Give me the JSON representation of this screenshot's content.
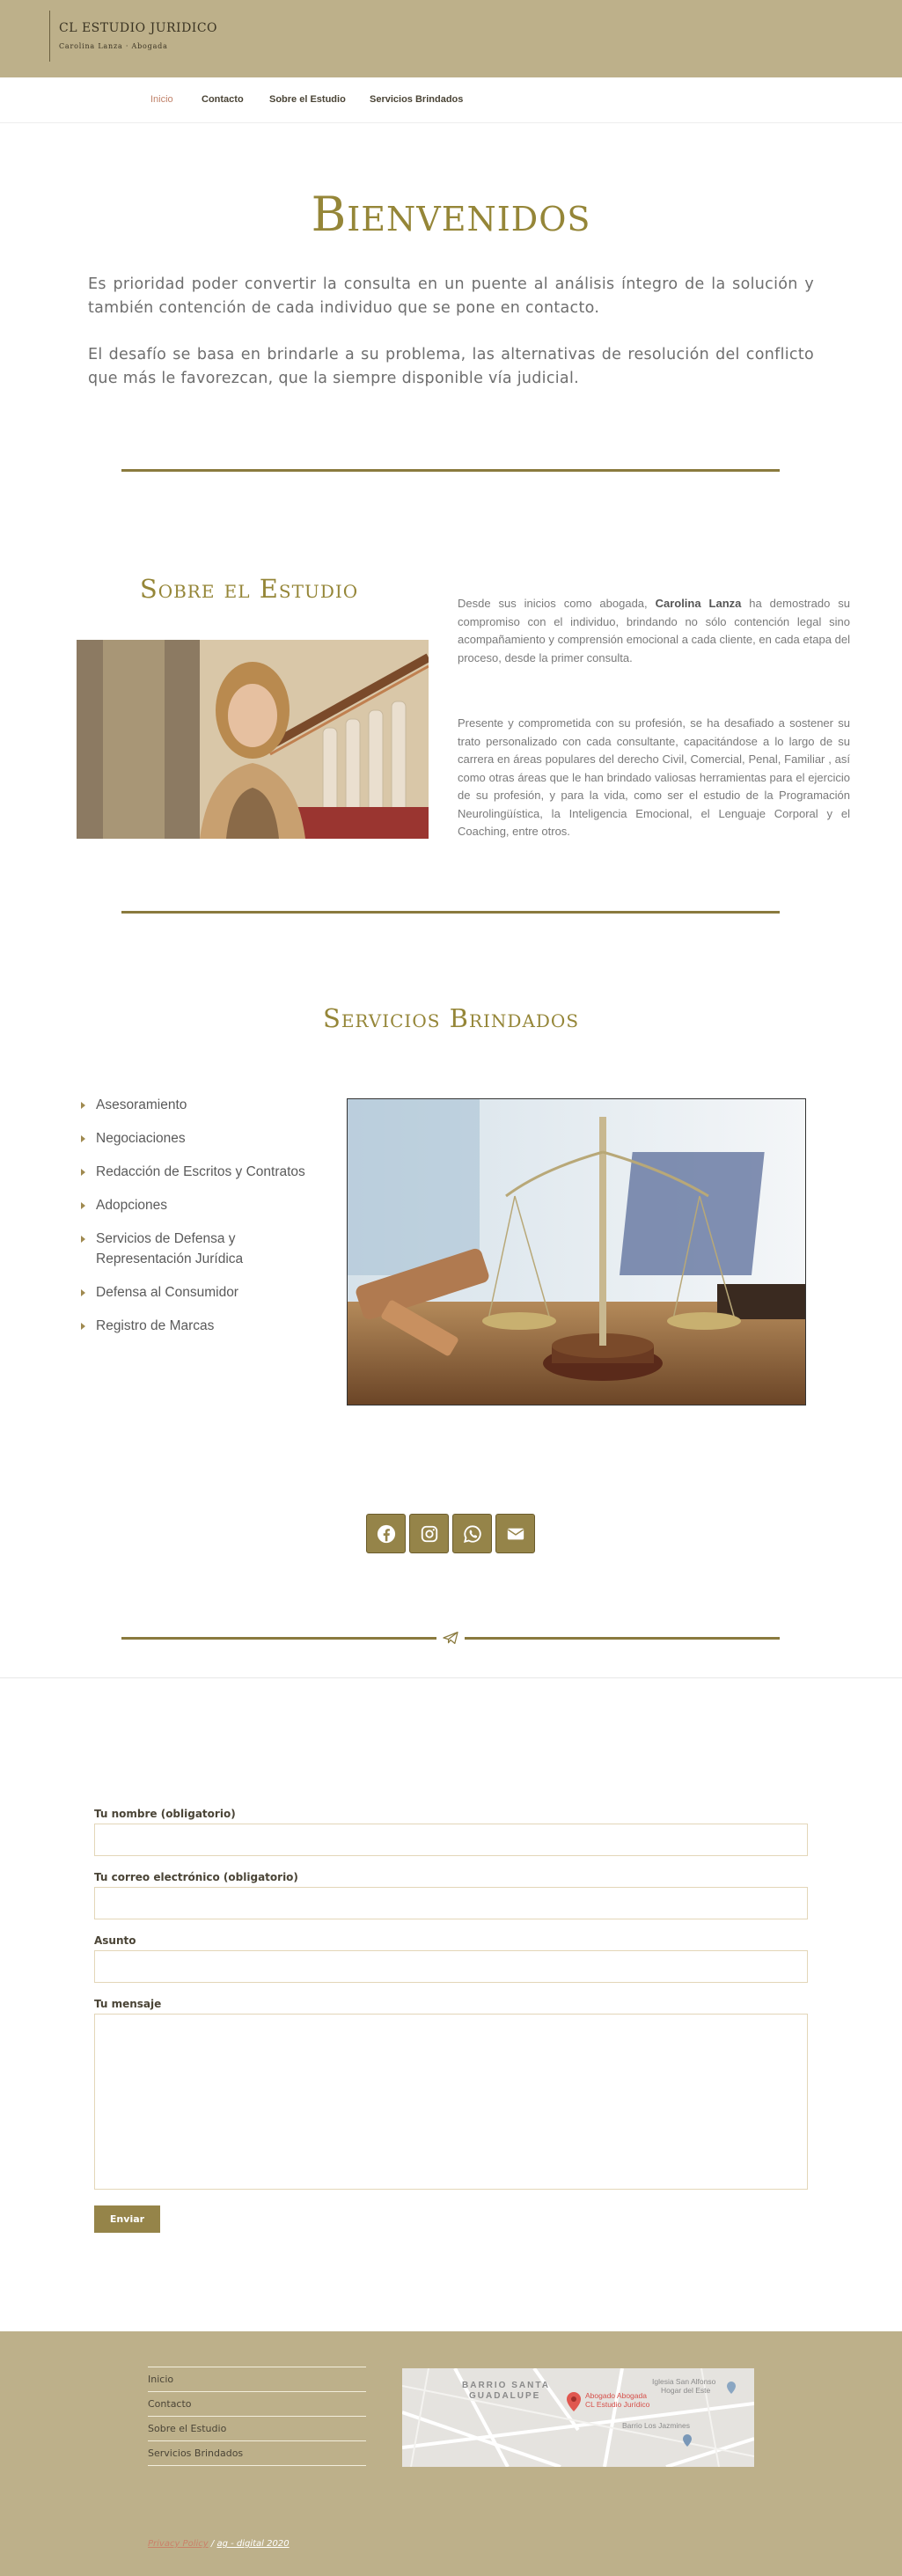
{
  "header": {
    "logo_title": "CL ESTUDIO JURIDICO",
    "logo_subtitle": "Carolina Lanza · Abogada"
  },
  "nav": {
    "items": [
      {
        "label": "Inicio",
        "active": true
      },
      {
        "label": "Contacto"
      },
      {
        "label": "Sobre el Estudio"
      },
      {
        "label": "Servicios Brindados"
      }
    ]
  },
  "welcome": {
    "title": "Bienvenidos",
    "paragraph1": "Es prioridad poder convertir la consulta en un puente al análisis íntegro de la  solución y también contención de cada individuo que se pone en contacto.",
    "paragraph2": "El desafío se basa en brindarle a su problema, las  alternativas de resolución del conflicto que más le favorezcan, que la siempre disponible vía judicial."
  },
  "about": {
    "title": "Sobre el Estudio",
    "p1_before": "Desde sus inicios como abogada, ",
    "p1_name": "Carolina Lanza",
    "p1_after": " ha demostrado su compromiso con el individuo, brindando no sólo contención legal sino acompañamiento y comprensión  emocional a cada cliente, en cada etapa del proceso, desde la primer consulta.",
    "p2": "Presente y comprometida con su profesión, se ha desafiado a sostener su trato personalizado con cada consultante, capacitándose a lo largo de su carrera en áreas populares del derecho Civil, Comercial, Penal, Familiar , así como otras áreas que le han brindado valiosas herramientas para el ejercicio de su profesión, y para la vida, como ser el estudio de la Programación Neurolingüística, la Inteligencia Emocional, el Lenguaje Corporal y el Coaching, entre otros."
  },
  "services": {
    "title": "Servicios Brindados",
    "items": [
      "Asesoramiento",
      "Negociaciones",
      "Redacción de Escritos y Contratos",
      "Adopciones",
      "Servicios de Defensa y Representación Jurídica",
      "Defensa al Consumidor",
      "Registro de Marcas"
    ]
  },
  "social": {
    "icons": [
      "facebook-icon",
      "instagram-icon",
      "whatsapp-icon",
      "envelope-icon"
    ]
  },
  "form": {
    "name_label": "Tu nombre (obligatorio)",
    "email_label": "Tu correo electrónico (obligatorio)",
    "subject_label": "Asunto",
    "message_label": "Tu mensaje",
    "submit_label": "Enviar"
  },
  "footer": {
    "links": [
      "Inicio",
      "Contacto",
      "Sobre el Estudio",
      "Servicios Brindados"
    ],
    "map": {
      "area1": "BARRIO SANTA",
      "area2": "GUADALUPE",
      "place": "Abogado Abogada",
      "place2": "CL Estudio Jurídico",
      "poi": "Iglesia San Alfonso",
      "poi2": "Hogar del Este",
      "barrio": "Barrio Los Jazmines"
    },
    "privacy": "Privacy Policy",
    "separator": "/",
    "brand": "ag - digital 2020"
  },
  "colors": {
    "brand_tan": "#bdb08a",
    "gold": "#958638",
    "accent": "#c0826a"
  }
}
